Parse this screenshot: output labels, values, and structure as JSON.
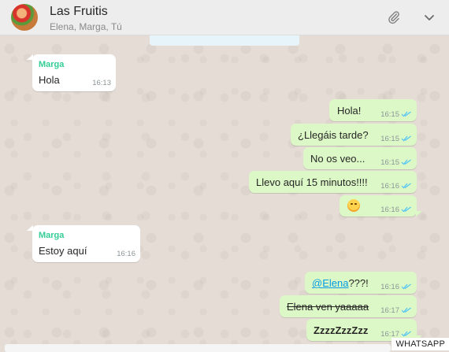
{
  "header": {
    "title": "Las Fruitis",
    "subtitle": "Elena, Marga, Tú",
    "icons": [
      "avatar-image",
      "paperclip-icon",
      "chevron-down-icon"
    ]
  },
  "messages": [
    {
      "type": "in",
      "sender": "Marga",
      "text": "Hola",
      "time": "16:13"
    },
    {
      "type": "out",
      "text": "Hola!",
      "time": "16:15"
    },
    {
      "type": "out",
      "text": "¿Llegáis tarde?",
      "time": "16:15"
    },
    {
      "type": "out",
      "text": "No os veo...",
      "time": "16:15"
    },
    {
      "type": "out",
      "text": "Llevo aquí 15 minutos!!!!",
      "time": "16:16"
    },
    {
      "type": "out",
      "emoji": "loudly-crying-face",
      "time": "16:16"
    },
    {
      "type": "in",
      "sender": "Marga",
      "text": "Estoy aquí",
      "time": "16:16"
    },
    {
      "type": "out",
      "mention": "@Elena",
      "text": "???!",
      "time": "16:16"
    },
    {
      "type": "out",
      "text": "Elena ven yaaaaa",
      "strikethrough": true,
      "time": "16:17"
    },
    {
      "type": "out",
      "text": "ZzzzZzzZzz",
      "bold": true,
      "time": "16:17"
    }
  ],
  "colors": {
    "header_bg": "#ededed",
    "chat_bg": "#e5ddd5",
    "outgoing_bubble": "#dcf8c6",
    "incoming_bubble": "#ffffff",
    "sender_name": "#35cd96",
    "read_ticks": "#4fc3f7",
    "mention": "#039be5"
  },
  "watermark": "WHATSAPP"
}
